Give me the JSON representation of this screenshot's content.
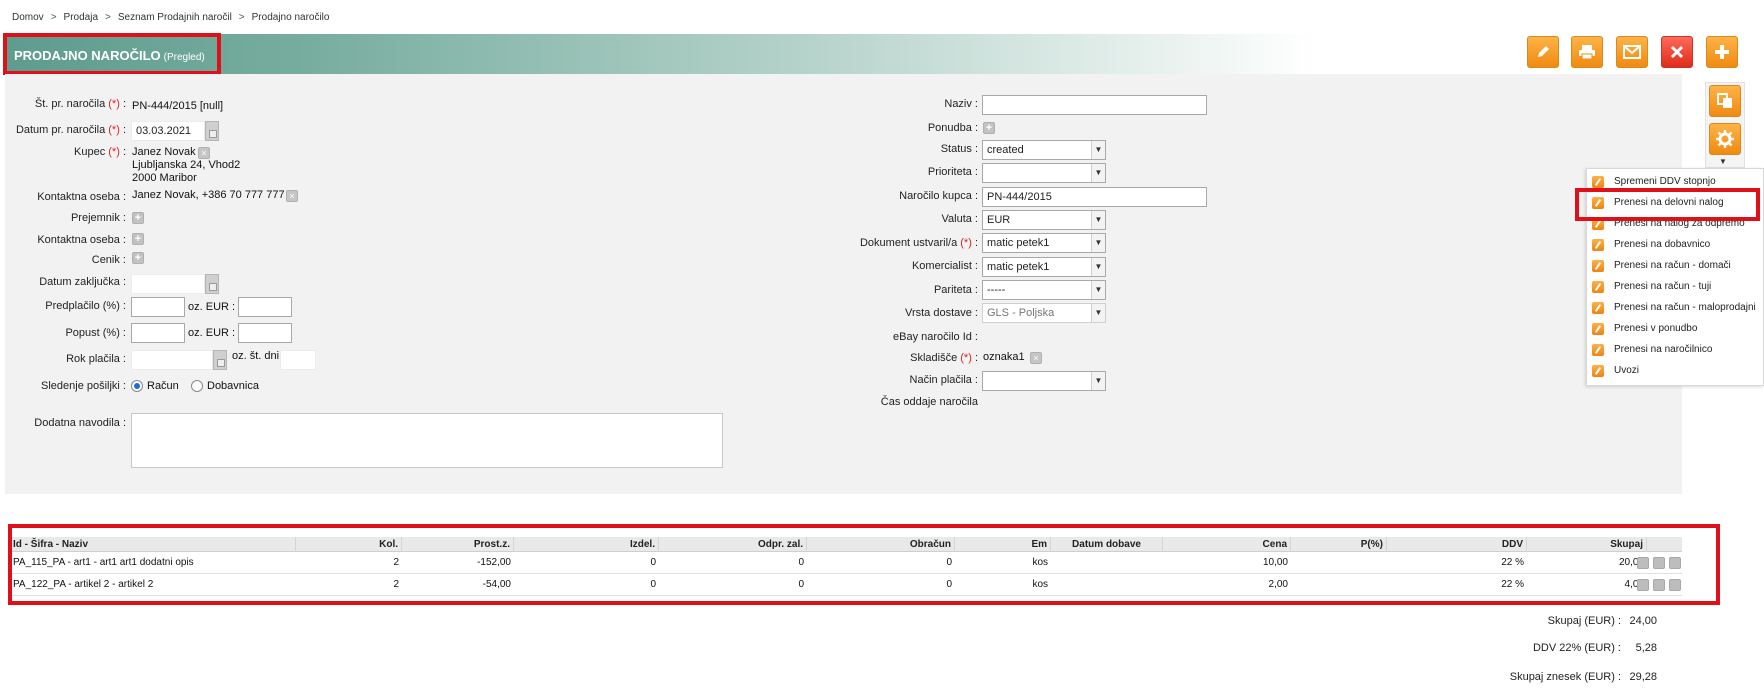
{
  "breadcrumb": [
    "Domov",
    "Prodaja",
    "Seznam Prodajnih naročil",
    "Prodajno naročilo"
  ],
  "page": {
    "title": "PRODAJNO NAROČILO",
    "mode": "(Pregled)"
  },
  "toolbar_icons": [
    "edit-icon",
    "print-icon",
    "mail-icon",
    "delete-icon",
    "add-icon"
  ],
  "side_icons": [
    "copy-icon",
    "gear-icon"
  ],
  "form_left": {
    "order_no_label": "Št. pr. naročila",
    "order_no": "PN-444/2015 [null]",
    "order_date_label": "Datum pr. naročila",
    "order_date": "03.03.2021",
    "buyer_label": "Kupec",
    "buyer_name": "Janez Novak",
    "buyer_street": "Ljubljanska 24, Vhod2",
    "buyer_city": "2000 Maribor",
    "contact_label": "Kontaktna oseba",
    "contact_value": "Janez Novak, +386 70 777 777",
    "recipient_label": "Prejemnik :",
    "contact2_label": "Kontaktna oseba :",
    "pricelist_label": "Cenik :",
    "close_date_label": "Datum zaključka :",
    "prepayment_label": "Predplačilo (%) :",
    "prepayment_eur_label": "oz. EUR :",
    "discount_label": "Popust (%) :",
    "discount_eur_label": "oz. EUR :",
    "payment_term_label": "Rok plačila :",
    "payment_days_label": "oz. št. dni",
    "tracking_label": "Sledenje pošiljki :",
    "tracking_invoice": "Račun",
    "tracking_delivery": "Dobavnica",
    "notes_label": "Dodatna navodila :",
    "required_mark": "(*)",
    "colon": ":"
  },
  "form_right": {
    "name_label": "Naziv :",
    "name_value": "",
    "offer_label": "Ponudba :",
    "status_label": "Status :",
    "status_value": "created",
    "priority_label": "Prioriteta :",
    "priority_value": "",
    "buyer_order_label": "Naročilo kupca :",
    "buyer_order_value": "PN-444/2015",
    "currency_label": "Valuta :",
    "currency_value": "EUR",
    "created_by_label": "Dokument ustvaril/a",
    "created_by_value": "matic petek1",
    "commercial_label": "Komercialist :",
    "commercial_value": "matic petek1",
    "parity_label": "Pariteta :",
    "parity_value": "-----",
    "shipping_label": "Vrsta dostave :",
    "shipping_value": "GLS - Poljska",
    "ebay_label": "eBay naročilo Id :",
    "warehouse_label": "Skladišče",
    "warehouse_value": "oznaka1",
    "payment_method_label": "Način plačila :",
    "payment_method_value": "",
    "order_time_label": "Čas oddaje naročila",
    "required_mark": "(*)",
    "colon": ":"
  },
  "menu": {
    "items": [
      "Spremeni DDV stopnjo",
      "Prenesi na delovni nalog",
      "Prenesi na nalog za odpremo",
      "Prenesi na dobavnico",
      "Prenesi na račun - domači",
      "Prenesi na račun - tuji",
      "Prenesi na račun - maloprodajni",
      "Prenesi v ponudbo",
      "Prenesi na naročilnico",
      "Uvozi"
    ],
    "highlighted_index": 1
  },
  "table": {
    "columns": [
      "Id - Šifra - Naziv",
      "Kol.",
      "Prost.z.",
      "Izdel.",
      "Odpr. zal.",
      "Obračun",
      "Em",
      "Datum dobave",
      "Cena",
      "P(%)",
      "DDV",
      "Skupaj"
    ],
    "rows": [
      [
        "PA_115_PA - art1 - art1 art1 dodatni opis",
        "2",
        "-152,00",
        "0",
        "0",
        "0",
        "kos",
        "",
        "10,00",
        "",
        "22 %",
        "20,00"
      ],
      [
        "PA_122_PA - artikel 2 - artikel 2",
        "2",
        "-54,00",
        "0",
        "0",
        "0",
        "kos",
        "",
        "2,00",
        "",
        "22 %",
        "4,00"
      ]
    ]
  },
  "totals": {
    "sum_label": "Skupaj (EUR) :",
    "sum_value": "24,00",
    "vat_label": "DDV 22% (EUR) :",
    "vat_value": "5,28",
    "grand_label": "Skupaj znesek (EUR) :",
    "grand_value": "29,28"
  },
  "colors": {
    "header_green": "#5e9c8d",
    "highlight_red": "#e0101a",
    "button_orange": "#f08a10"
  }
}
